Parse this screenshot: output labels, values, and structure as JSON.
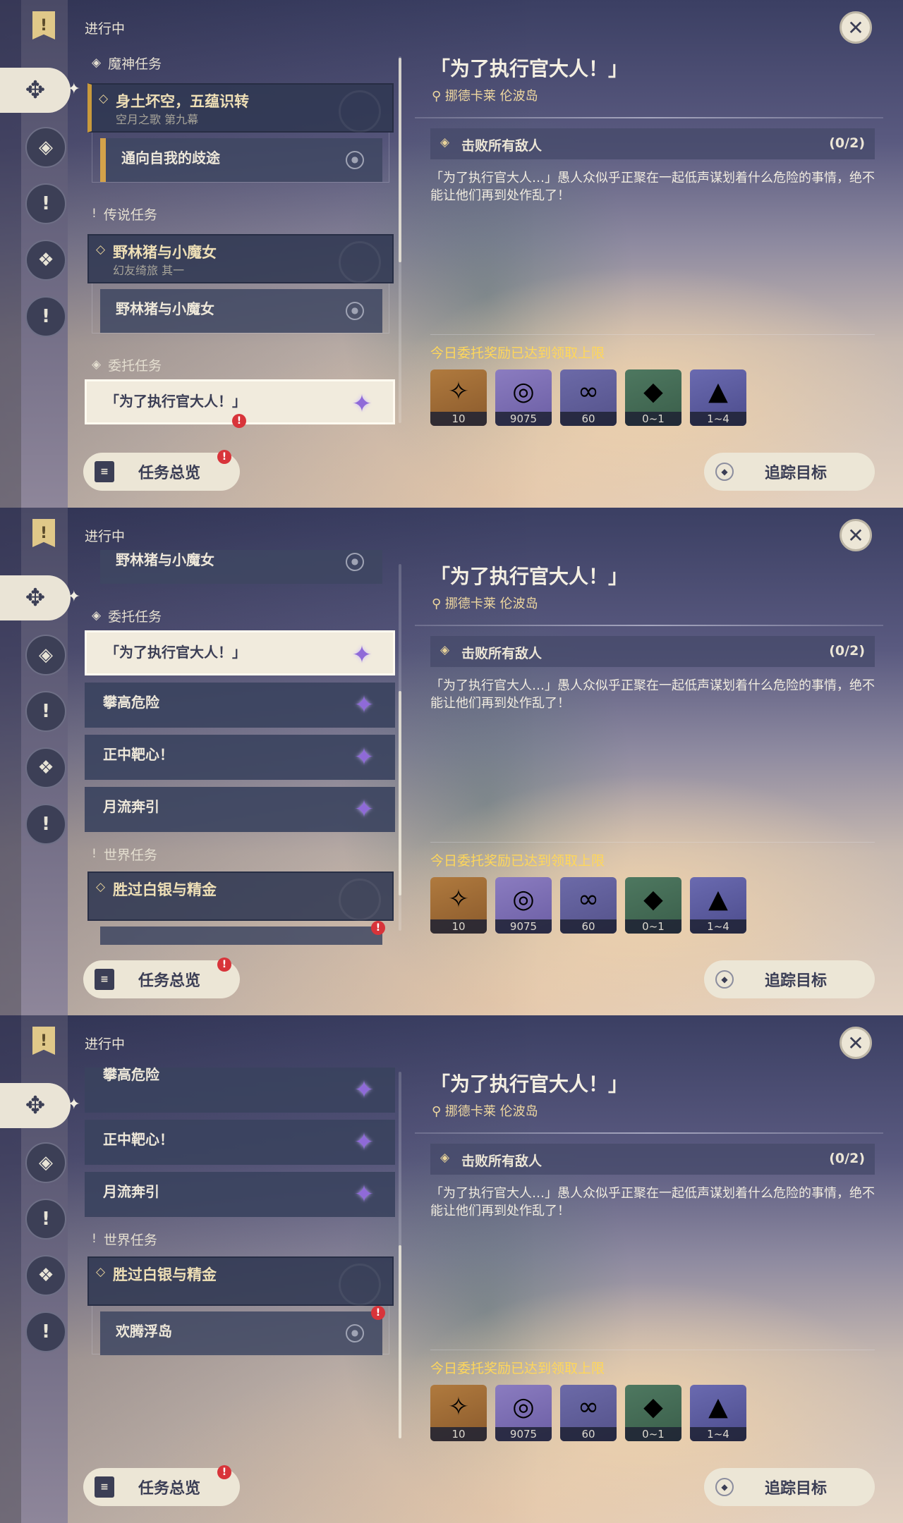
{
  "header": {
    "in_progress": "进行中"
  },
  "categories": {
    "archon": "魔神任务",
    "story": "传说任务",
    "commission": "委托任务",
    "world": "世界任务"
  },
  "archon_quest": {
    "title": "身土坏空，五蕴识转",
    "subtitle": "空月之歌 第九幕",
    "step": "通向自我的歧途"
  },
  "story_quest": {
    "title": "野林猪与小魔女",
    "subtitle": "幻友绮旅 其一",
    "step": "野林猪与小魔女"
  },
  "commissions": [
    "「为了执行官大人！」",
    "攀高危险",
    "正中靶心！",
    "月流奔引"
  ],
  "world_quest": {
    "title": "胜过白银与精金",
    "step": "欢腾浮岛"
  },
  "detail": {
    "title": "「为了执行官大人！」",
    "location": "挪德卡莱 伦波岛",
    "objective": "击败所有敌人",
    "objective_count": "(0/2)",
    "description": "「为了执行官大人…」愚人众似乎正聚在一起低声谋划着什么危险的事情，绝不能让他们再到处作乱了！",
    "reward_note": "今日委托奖励已达到领取上限",
    "rewards": [
      {
        "icon": "primogem-icon",
        "amount": "10"
      },
      {
        "icon": "mora-icon",
        "amount": "9075"
      },
      {
        "icon": "companionship-exp-icon",
        "amount": "60"
      },
      {
        "icon": "ore-icon",
        "amount": "0~1"
      },
      {
        "icon": "crystal-icon",
        "amount": "1~4"
      }
    ]
  },
  "buttons": {
    "overview": "任务总览",
    "track": "追踪目标"
  },
  "alert_mark": "!",
  "colors": {
    "accent_gold": "#ffd75a",
    "alert_red": "#d8343a",
    "button_bg": "#ece6d6",
    "commission_star": "#8f6ad8"
  }
}
